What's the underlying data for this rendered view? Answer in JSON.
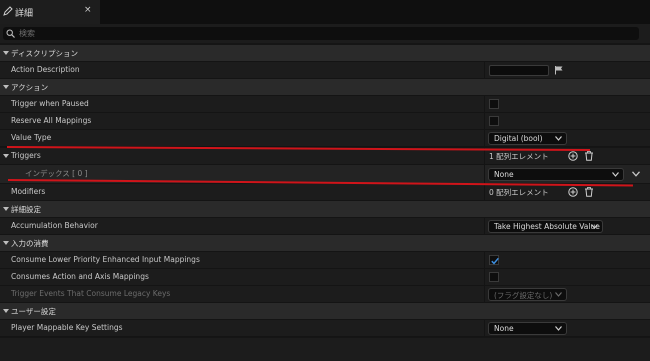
{
  "tab": {
    "title": "詳細",
    "close": "×"
  },
  "search": {
    "placeholder": "検索"
  },
  "sections": {
    "description": {
      "title": "ディスクリプション",
      "action_description": "Action Description"
    },
    "action": {
      "title": "アクション",
      "trigger_when_paused": "Trigger when Paused",
      "reserve_all_mappings": "Reserve All Mappings",
      "value_type": {
        "label": "Value Type",
        "value": "Digital (bool)"
      },
      "triggers": {
        "label": "Triggers",
        "count_text": "1 配列エレメント",
        "index_label": "インデックス [ 0 ]",
        "index_value": "None"
      },
      "modifiers": {
        "label": "Modifiers",
        "count_text": "0 配列エレメント"
      }
    },
    "advanced": {
      "title": "詳細設定",
      "accumulation_behavior": {
        "label": "Accumulation Behavior",
        "value": "Take Highest Absolute Value"
      }
    },
    "input_consumption": {
      "title": "入力の消費",
      "consume_lower": {
        "label": "Consume Lower Priority Enhanced Input Mappings",
        "checked": true
      },
      "consumes_action_axis": {
        "label": "Consumes Action and Axis Mappings",
        "checked": false
      },
      "trigger_events": {
        "label": "Trigger Events That Consume Legacy Keys",
        "value": "(フラグ設定なし)"
      }
    },
    "user_settings": {
      "title": "ユーザー設定",
      "player_mappable": {
        "label": "Player Mappable Key Settings",
        "value": "None"
      }
    }
  },
  "colors": {
    "annotation": "#d0141a",
    "checkmark": "#3d8fe0"
  }
}
